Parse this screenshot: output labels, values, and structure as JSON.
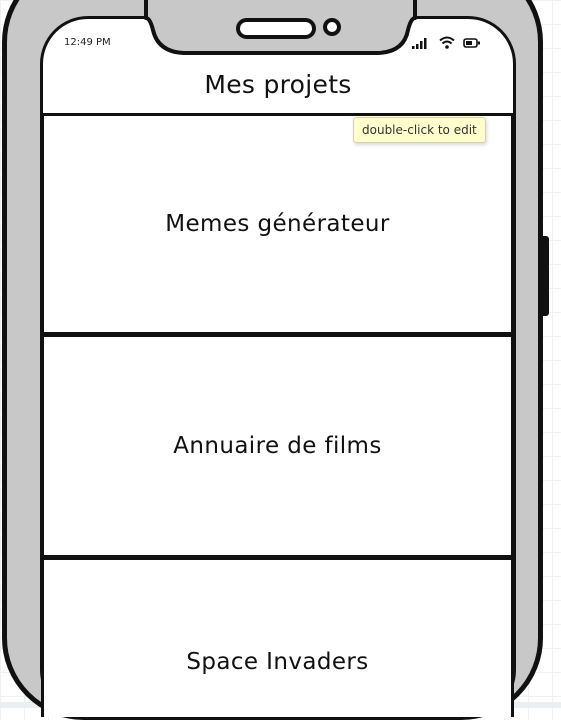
{
  "status_bar": {
    "time": "12:49 PM"
  },
  "header": {
    "title": "Mes projets"
  },
  "projects": [
    {
      "label": "Memes générateur"
    },
    {
      "label": "Annuaire de films"
    },
    {
      "label": "Space Invaders"
    }
  ],
  "tooltip": {
    "text": "double-click to edit"
  },
  "colors": {
    "frame": "#c8c8c8",
    "outline": "#111111",
    "tooltip_bg": "#fffecc"
  },
  "icons": [
    "signal-icon",
    "wifi-icon",
    "battery-icon"
  ]
}
